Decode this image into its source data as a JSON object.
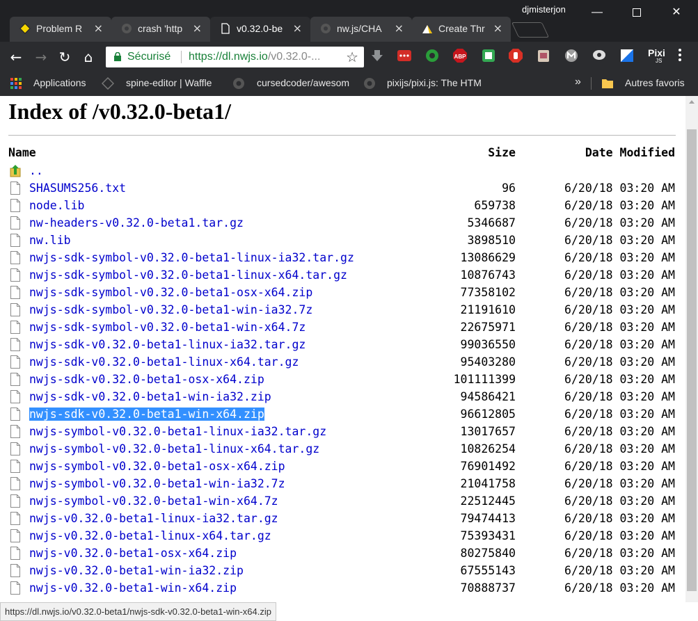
{
  "window": {
    "profile_name": "djmisterjon",
    "controls": {
      "minimize": "—",
      "close": "✕"
    }
  },
  "tabs": [
    {
      "label": "Problem R",
      "icon": "warning-icon",
      "active": false
    },
    {
      "label": "crash 'http",
      "icon": "github-icon",
      "active": false
    },
    {
      "label": "v0.32.0-be",
      "icon": "page-icon",
      "active": true
    },
    {
      "label": "nw.js/CHA",
      "icon": "github-icon",
      "active": false
    },
    {
      "label": "Create Thr",
      "icon": "forum-icon",
      "active": false
    }
  ],
  "toolbar": {
    "back": "←",
    "forward": "→",
    "reload": "↻",
    "home": "⌂",
    "secure_label": "Sécurisé",
    "url_scheme_host": "https://dl.nwjs.io",
    "url_path": "/v0.32.0-...",
    "star": "☆",
    "extensions": [
      {
        "name": "download-icon",
        "color": "#3c4043"
      },
      {
        "name": "lastpass-icon",
        "color": "#d32d27"
      },
      {
        "name": "green-circle-icon",
        "color": "#2a9d3a"
      },
      {
        "name": "adblock-plus-icon",
        "color": "#c7161d"
      },
      {
        "name": "print-icon",
        "color": "#34a853"
      },
      {
        "name": "adblock-hand-icon",
        "color": "#d93025"
      },
      {
        "name": "clipboard-icon",
        "color": "#b05566"
      },
      {
        "name": "mailtrack-icon",
        "color": "#9e9e9e"
      },
      {
        "name": "chat-icon",
        "color": "#dddddd"
      },
      {
        "name": "window-icon",
        "color": "#1a73e8"
      },
      {
        "name": "pixijs-icon",
        "color": "#2b2c2f"
      }
    ],
    "pixi_label": "Pixi",
    "pixi_sub": "JS"
  },
  "bookmarks": {
    "items": [
      {
        "label": "Applications",
        "icon": "apps-grid-icon"
      },
      {
        "label": "spine-editor | Waffle",
        "icon": "waffle-icon"
      },
      {
        "label": "cursedcoder/awesom",
        "icon": "github-icon"
      },
      {
        "label": "pixijs/pixi.js: The HTM",
        "icon": "github-icon"
      }
    ],
    "overflow": "»",
    "other_label": "Autres favoris"
  },
  "page": {
    "title": "Index of /v0.32.0-beta1/",
    "headers": {
      "name": "Name",
      "size": "Size",
      "date": "Date Modified"
    },
    "parent": "..",
    "files": [
      {
        "name": "SHASUMS256.txt",
        "size": "96",
        "date": "6/20/18 03:20 AM"
      },
      {
        "name": "node.lib",
        "size": "659738",
        "date": "6/20/18 03:20 AM"
      },
      {
        "name": "nw-headers-v0.32.0-beta1.tar.gz",
        "size": "5346687",
        "date": "6/20/18 03:20 AM"
      },
      {
        "name": "nw.lib",
        "size": "3898510",
        "date": "6/20/18 03:20 AM"
      },
      {
        "name": "nwjs-sdk-symbol-v0.32.0-beta1-linux-ia32.tar.gz",
        "size": "13086629",
        "date": "6/20/18 03:20 AM"
      },
      {
        "name": "nwjs-sdk-symbol-v0.32.0-beta1-linux-x64.tar.gz",
        "size": "10876743",
        "date": "6/20/18 03:20 AM"
      },
      {
        "name": "nwjs-sdk-symbol-v0.32.0-beta1-osx-x64.zip",
        "size": "77358102",
        "date": "6/20/18 03:20 AM"
      },
      {
        "name": "nwjs-sdk-symbol-v0.32.0-beta1-win-ia32.7z",
        "size": "21191610",
        "date": "6/20/18 03:20 AM"
      },
      {
        "name": "nwjs-sdk-symbol-v0.32.0-beta1-win-x64.7z",
        "size": "22675971",
        "date": "6/20/18 03:20 AM"
      },
      {
        "name": "nwjs-sdk-v0.32.0-beta1-linux-ia32.tar.gz",
        "size": "99036550",
        "date": "6/20/18 03:20 AM"
      },
      {
        "name": "nwjs-sdk-v0.32.0-beta1-linux-x64.tar.gz",
        "size": "95403280",
        "date": "6/20/18 03:20 AM"
      },
      {
        "name": "nwjs-sdk-v0.32.0-beta1-osx-x64.zip",
        "size": "101111399",
        "date": "6/20/18 03:20 AM"
      },
      {
        "name": "nwjs-sdk-v0.32.0-beta1-win-ia32.zip",
        "size": "94586421",
        "date": "6/20/18 03:20 AM"
      },
      {
        "name": "nwjs-sdk-v0.32.0-beta1-win-x64.zip",
        "size": "96612805",
        "date": "6/20/18 03:20 AM",
        "selected": true
      },
      {
        "name": "nwjs-symbol-v0.32.0-beta1-linux-ia32.tar.gz",
        "size": "13017657",
        "date": "6/20/18 03:20 AM"
      },
      {
        "name": "nwjs-symbol-v0.32.0-beta1-linux-x64.tar.gz",
        "size": "10826254",
        "date": "6/20/18 03:20 AM"
      },
      {
        "name": "nwjs-symbol-v0.32.0-beta1-osx-x64.zip",
        "size": "76901492",
        "date": "6/20/18 03:20 AM"
      },
      {
        "name": "nwjs-symbol-v0.32.0-beta1-win-ia32.7z",
        "size": "21041758",
        "date": "6/20/18 03:20 AM"
      },
      {
        "name": "nwjs-symbol-v0.32.0-beta1-win-x64.7z",
        "size": "22512445",
        "date": "6/20/18 03:20 AM"
      },
      {
        "name": "nwjs-v0.32.0-beta1-linux-ia32.tar.gz",
        "size": "79474413",
        "date": "6/20/18 03:20 AM"
      },
      {
        "name": "nwjs-v0.32.0-beta1-linux-x64.tar.gz",
        "size": "75393431",
        "date": "6/20/18 03:20 AM"
      },
      {
        "name": "nwjs-v0.32.0-beta1-osx-x64.zip",
        "size": "80275840",
        "date": "6/20/18 03:20 AM"
      },
      {
        "name": "nwjs-v0.32.0-beta1-win-ia32.zip",
        "size": "67555143",
        "date": "6/20/18 03:20 AM"
      },
      {
        "name": "nwjs-v0.32.0-beta1-win-x64.zip",
        "size": "70888737",
        "date": "6/20/18 03:20 AM"
      }
    ]
  },
  "status_url": "https://dl.nwjs.io/v0.32.0-beta1/nwjs-sdk-v0.32.0-beta1-win-x64.zip"
}
